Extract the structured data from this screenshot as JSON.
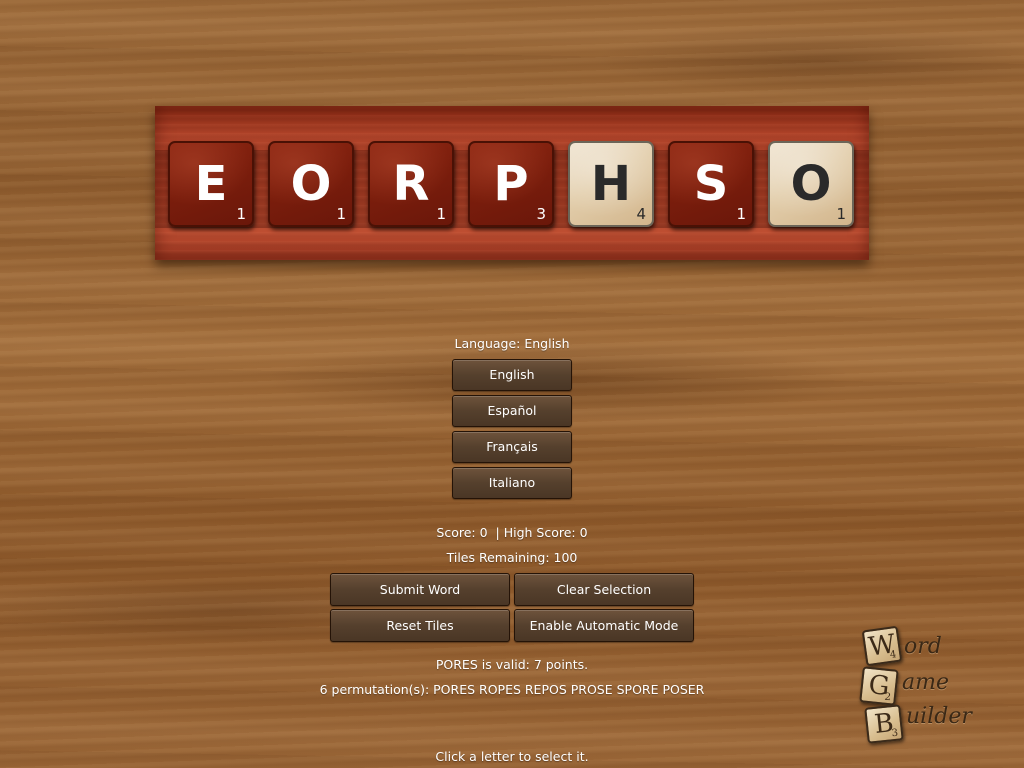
{
  "rack": {
    "tiles": [
      {
        "letter": "E",
        "value": "1",
        "style": "red"
      },
      {
        "letter": "O",
        "value": "1",
        "style": "red"
      },
      {
        "letter": "R",
        "value": "1",
        "style": "red"
      },
      {
        "letter": "P",
        "value": "3",
        "style": "red"
      },
      {
        "letter": "H",
        "value": "4",
        "style": "wood"
      },
      {
        "letter": "S",
        "value": "1",
        "style": "red"
      },
      {
        "letter": "O",
        "value": "1",
        "style": "wood"
      }
    ]
  },
  "language": {
    "current_label": "Language: English",
    "options": [
      "English",
      "Español",
      "Français",
      "Italiano"
    ]
  },
  "stats": {
    "score_line": "Score: 0  | High Score: 0",
    "tiles_remaining": "Tiles Remaining: 100"
  },
  "actions": {
    "submit_word": "Submit Word",
    "clear_selection": "Clear Selection",
    "reset_tiles": "Reset Tiles",
    "enable_auto": "Enable Automatic Mode"
  },
  "result": {
    "valid_message": "PORES is valid: 7 points.",
    "permutations": "6 permutation(s): PORES ROPES REPOS PROSE SPORE POSER"
  },
  "hint": "Click a letter to select it.",
  "logo": {
    "tiles": [
      {
        "letter": "W",
        "value": "4"
      },
      {
        "letter": "G",
        "value": "2"
      },
      {
        "letter": "B",
        "value": "3"
      }
    ],
    "words": [
      "ord",
      "ame",
      "uilder"
    ]
  },
  "colors": {
    "tile_red": "#7a1d0c",
    "tile_wood": "#e2cdaa",
    "rack": "#a13a22",
    "button": "#55402d",
    "text": "#ffffff"
  }
}
